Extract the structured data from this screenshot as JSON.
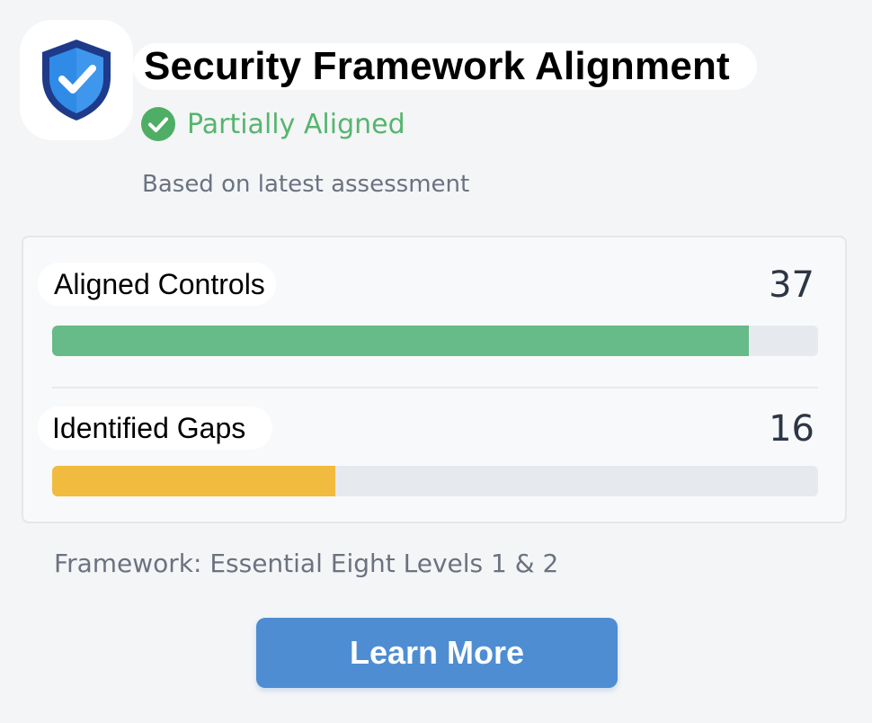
{
  "header": {
    "title": "Security Framework Alignment",
    "icon": "shield-check-icon"
  },
  "status": {
    "icon": "check-circle-icon",
    "text": "Partially Aligned",
    "color": "#56b56d"
  },
  "subtitle": "Based on latest assessment",
  "metrics": [
    {
      "label": "Aligned Controls",
      "value": "37",
      "progress_percent": 91,
      "color": "#66bb88"
    },
    {
      "label": "Identified Gaps",
      "value": "16",
      "progress_percent": 37,
      "color": "#f1bb3f"
    }
  ],
  "framework": "Framework: Essential Eight Levels 1 & 2",
  "actions": {
    "learn_more_label": "Learn More",
    "button_color": "#4e8dd2"
  },
  "colors": {
    "shield_outer": "#1e3a8a",
    "shield_inner": "#2f8be6",
    "background": "#f4f5f7"
  }
}
